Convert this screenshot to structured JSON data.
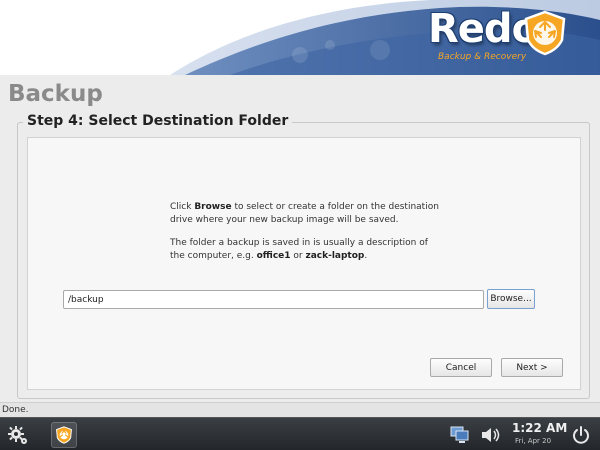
{
  "banner": {
    "logo_text": "Redo",
    "logo_subtitle": "Backup & Recovery",
    "brand_color": "#2f5a9a",
    "accent_color": "#f6a623"
  },
  "app": {
    "title": "Backup",
    "step_title": "Step 4: Select Destination Folder",
    "info": {
      "line1_prefix": "Click ",
      "line1_bold": "Browse",
      "line1_suffix": " to select or create a folder on the destination drive where your new backup image will be saved.",
      "line2_prefix": "The folder a backup is saved in is usually a description of the computer, e.g. ",
      "line2_bold1": "office1",
      "line2_mid": " or ",
      "line2_bold2": "zack-laptop",
      "line2_suffix": "."
    },
    "path_value": "/backup",
    "browse_label": "Browse...",
    "cancel_label": "Cancel",
    "next_label": "Next >"
  },
  "status": {
    "text": "Done."
  },
  "taskbar": {
    "settings_icon": "gear-icon",
    "app_icon": "redo-recycle-icon",
    "network_icon": "network-icon",
    "volume_icon": "volume-icon",
    "time": "1:22 AM",
    "date": "Fri, Apr 20",
    "power_icon": "power-icon"
  }
}
